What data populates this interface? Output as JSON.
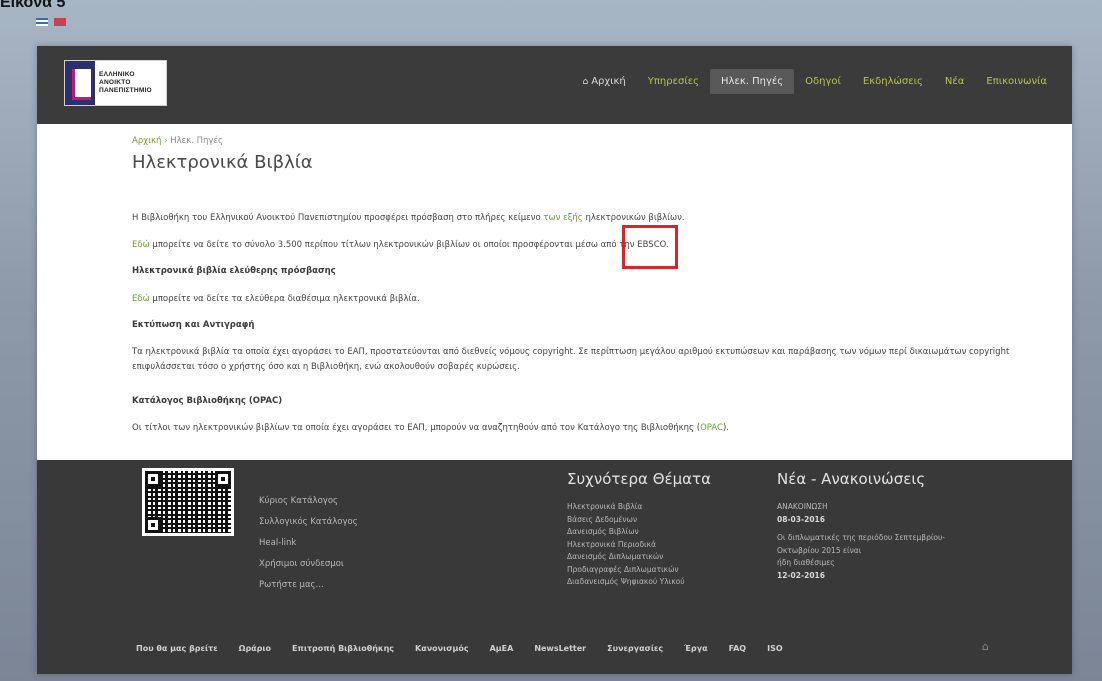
{
  "caption": "Εικόνα 5",
  "header": {
    "logo": {
      "line1": "ΕΛΛΗΝΙΚΟ",
      "line2": "ΑΝΟΙΚΤΟ",
      "line3": "ΠΑΝΕΠΙΣΤΗΜΙΟ"
    },
    "nav": [
      {
        "label": "Αρχική",
        "icon": "home-icon"
      },
      {
        "label": "Υπηρεσίες"
      },
      {
        "label": "Ηλεκ. Πηγές",
        "active": true
      },
      {
        "label": "Οδηγοί"
      },
      {
        "label": "Εκδηλώσεις"
      },
      {
        "label": "Νέα"
      },
      {
        "label": "Επικοινωνία"
      }
    ]
  },
  "breadcrumb": {
    "home": "Αρχική",
    "sep": "›",
    "current": "Ηλεκ. Πηγές"
  },
  "title": "Ηλεκτρονικά Βιβλία",
  "paragraphs": {
    "p1_before": "Η Βιβλιοθήκη του Ελληνικού Ανοικτού Πανεπιστημίου προσφέρει πρόσβαση στο πλήρες κείμενο ",
    "p1_link": "των εξής",
    "p1_after": " ηλεκτρονικών βιβλίων.",
    "p2_link": "Εδώ",
    "p2_after": " μπορείτε να δείτε το σύνολο 3.500 περίπου τίτλων ηλεκτρονικών βιβλίων οι οποίοι προσφέρονται μέσω από την EBSCO.",
    "h1": "Ηλεκτρονικά βιβλία ελεύθερης πρόσβασης",
    "p3_link": "Εδώ",
    "p3_after": " μπορείτε να δείτε τα ελεύθερα διαθέσιμα ηλεκτρονικά βιβλία.",
    "h2": "Εκτύπωση και Αντιγραφή",
    "p4": "Τα ηλεκτρονικά βιβλία τα οποία έχει αγοράσει το ΕΑΠ, προστατεύονται από διεθνείς νόμους copyright. Σε περίπτωση μεγάλου αριθμού εκτυπώσεων και παράβασης των νόμων περί δικαιωμάτων copyright επιφυλάσσεται τόσο ο χρήστης όσο και η Βιβλιοθήκη, ενώ ακολουθούν σοβαρές κυρώσεις.",
    "h3": "Κατάλογος Βιβλιοθήκης (OPAC)",
    "p5_before": "Οι τίτλοι των ηλεκτρονικών βιβλίων τα οποία έχει αγοράσει το ΕΑΠ, μπορούν να αναζητηθούν από τον Κατάλογο της Βιβλιοθήκης (",
    "p5_link": "OPAC",
    "p5_after": ")."
  },
  "footer": {
    "links": [
      "Κύριος Κατάλογος",
      "Συλλογικός Κατάλογος",
      "Heal-link",
      "Χρήσιμοι σύνδεσμοι",
      "Ρωτήστε μας..."
    ],
    "topics_title": "Συχνότερα Θέματα",
    "topics": [
      "Ηλεκτρονικά Βιβλία",
      "Βάσεις Δεδομένων",
      "Δανεισμός Βιβλίων",
      "Ηλεκτρονικά Περιοδικά",
      "Δανεισμός Διπλωματικών",
      "Προδιαγραφές Διπλωματικών",
      "Διαδανεισμός Ψηφιακού Υλικού"
    ],
    "news_title": "Νέα - Ανακοινώσεις",
    "news": {
      "label1": "ΑΝΑΚΟΙΝΩΣΗ",
      "date1": "08-03-2016",
      "text1": "Οι διπλωματικές της περιόδου Σεπτεμβρίου-Οκτωβρίου 2015 είναι",
      "text1b": "ήδη διαθέσιμες",
      "date2": "12-02-2016"
    },
    "bottom": [
      "Που θα μας βρείτε",
      "Ωράριο",
      "Επιτροπή Βιβλιοθήκης",
      "Κανονισμός",
      "ΑμΕΑ",
      "NewsLetter",
      "Συνεργασίες",
      "Έργα",
      "FAQ",
      "ISO"
    ]
  }
}
